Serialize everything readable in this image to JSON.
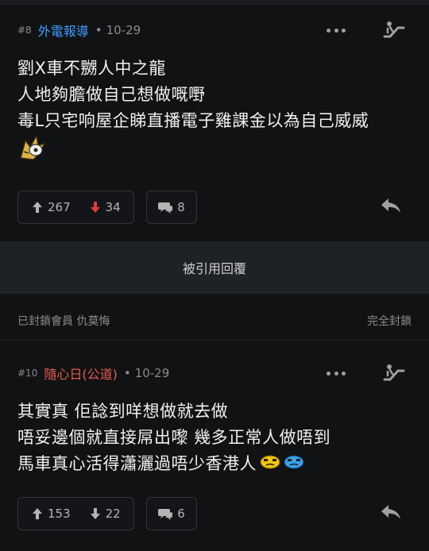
{
  "post1": {
    "number": "#8",
    "author": "外電報導",
    "author_color": "#3f9cff",
    "date": "10-29",
    "lines": [
      "劉X車不嬲人中之龍",
      "人地夠膽做自己想做嘅嘢",
      "毒L只宅响屋企睇直播電子雞課金以為自己威威"
    ],
    "upvotes": "267",
    "downvotes": "34",
    "comments": "8",
    "downvote_color": "#e23b3b"
  },
  "quote_bar": {
    "label": "被引用回覆"
  },
  "blocked": {
    "left": "已封鎖會員 仇莫悔",
    "right": "完全封鎖"
  },
  "post2": {
    "number": "#10",
    "author": "隨心日(公道)",
    "author_color": "#e65a4f",
    "date": "10-29",
    "lines": [
      "其實真 佢諗到咩想做就去做",
      "唔妥邊個就直接屌出嚟 幾多正常人做唔到",
      "馬車真心活得瀟灑過唔少香港人"
    ],
    "upvotes": "153",
    "downvotes": "22",
    "comments": "6"
  },
  "icons": {
    "more": "more-dots-icon",
    "share": "escalator-icon",
    "upvote": "arrow-up-icon",
    "downvote": "arrow-down-icon",
    "comment": "speech-bubble-icon",
    "reply": "reply-arrow-icon",
    "emoji": "bird-sticker-icon",
    "emoji2": "crying-face-icon"
  }
}
